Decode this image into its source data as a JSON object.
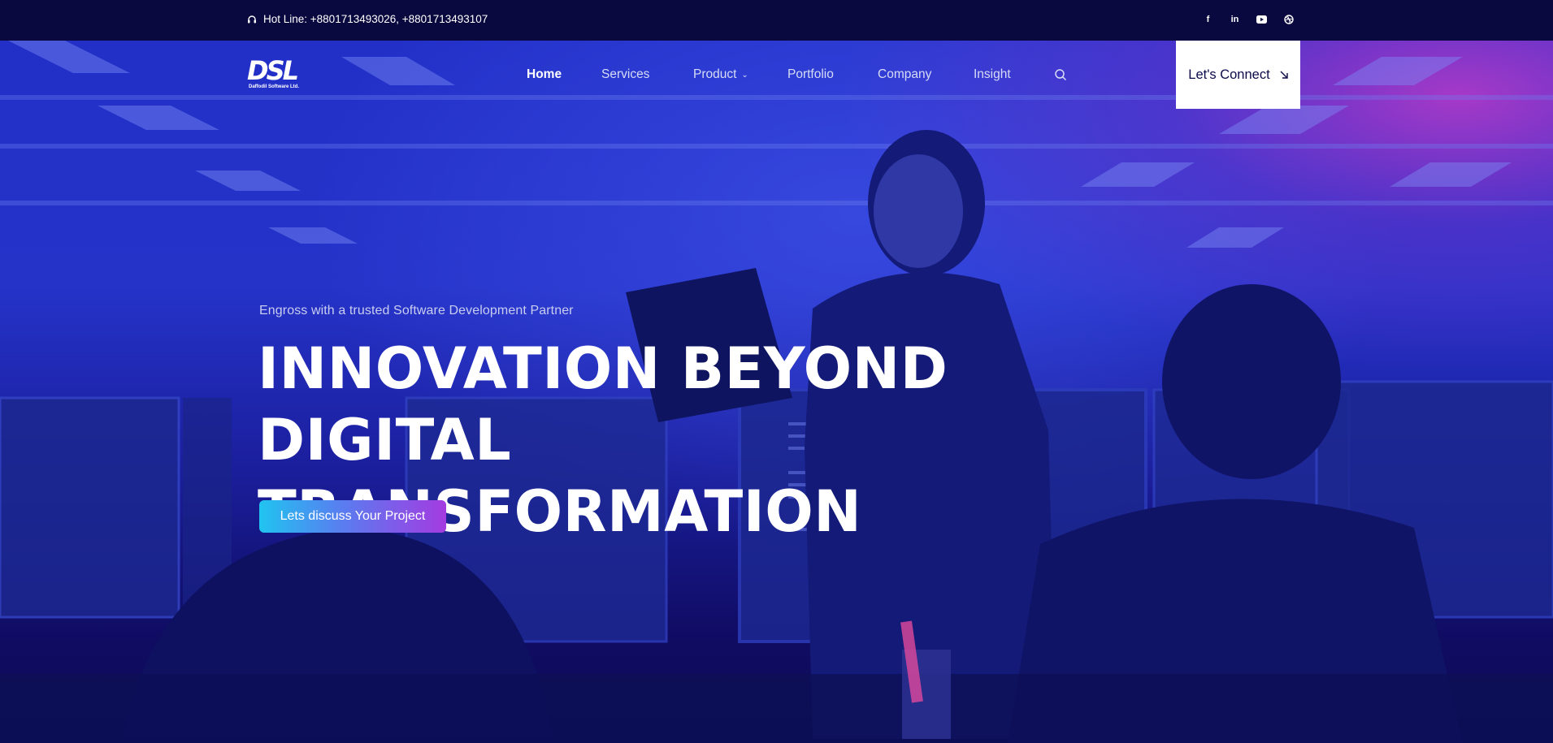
{
  "topbar": {
    "hotline_label": "Hot Line: +8801713493026, +8801713493107",
    "hotline_icon": "headset-icon",
    "socials": [
      {
        "name": "facebook-icon",
        "glyph": "f"
      },
      {
        "name": "linkedin-icon",
        "glyph": "in"
      },
      {
        "name": "youtube-icon",
        "glyph": "▶"
      },
      {
        "name": "dribbble-icon",
        "glyph": "⊛"
      }
    ]
  },
  "header": {
    "logo_mark": "DSL",
    "logo_text": "Daffodil Software Ltd.",
    "nav": [
      {
        "label": "Home",
        "active": true
      },
      {
        "label": "Services",
        "active": false
      },
      {
        "label": "Product",
        "active": false,
        "has_dropdown": true
      },
      {
        "label": "Portfolio",
        "active": false
      },
      {
        "label": "Company",
        "active": false
      },
      {
        "label": "Insight",
        "active": false
      }
    ],
    "search_icon": "search-icon",
    "connect_label": "Let's Connect",
    "connect_icon": "arrow-down-right-icon"
  },
  "hero": {
    "tagline": "Engross with a trusted Software Development Partner",
    "headline_line1": "INNOVATION BEYOND DIGITAL",
    "headline_line2": "TRANSFORMATION",
    "cta_label": "Lets discuss Your Project"
  },
  "colors": {
    "topbar_bg": "#09083f",
    "hero_blue": "#2230c8",
    "accent_magenta": "#d23cc8",
    "cta_start": "#21c4f0",
    "cta_end": "#a43be0"
  }
}
